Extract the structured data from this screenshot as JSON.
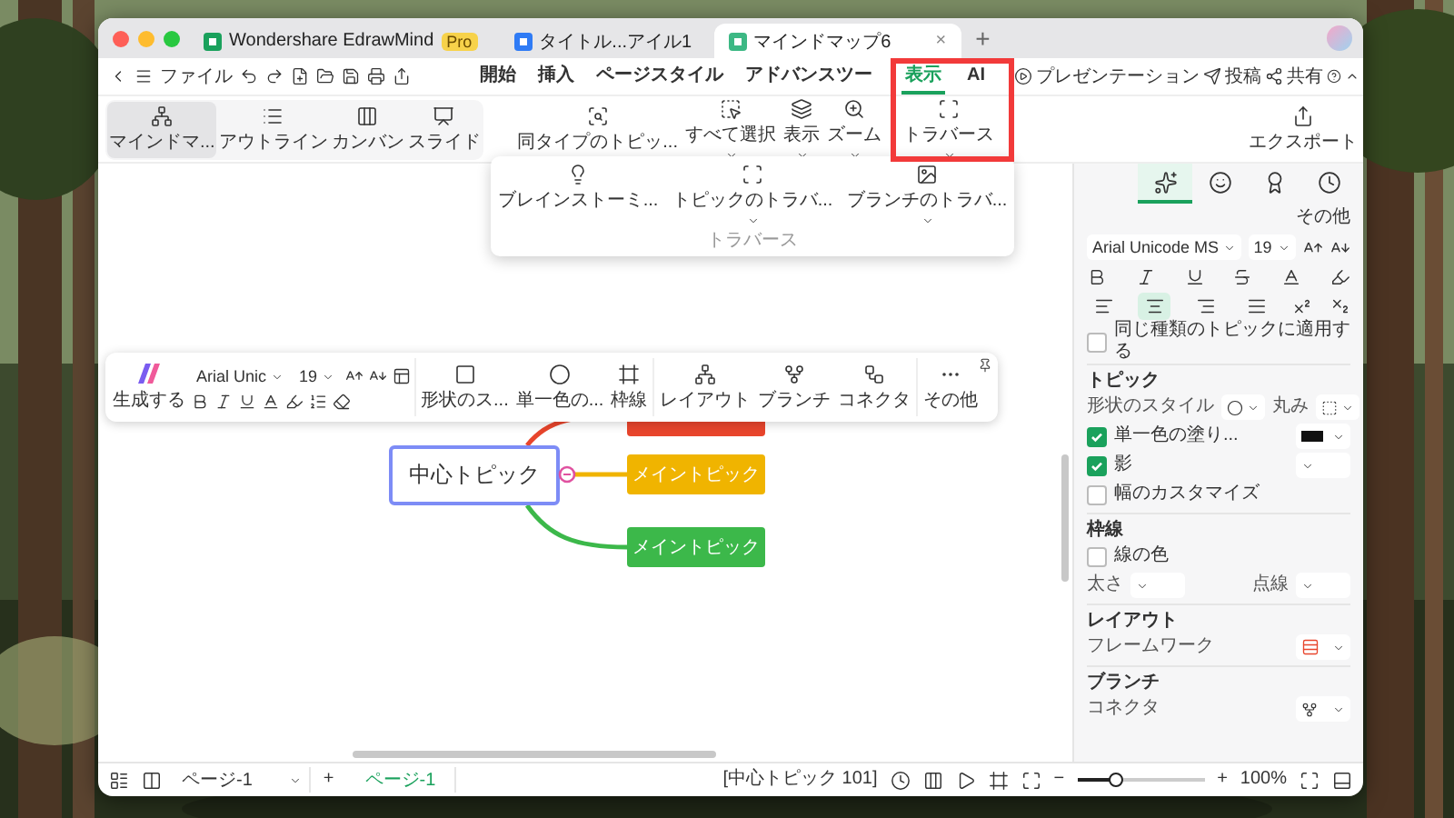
{
  "window": {
    "tabs": [
      {
        "kind": "app",
        "label": "Wondershare EdrawMind",
        "badge": "Pro",
        "selected": false
      },
      {
        "kind": "doc",
        "label": "タイトル...アイル1",
        "selected": false
      },
      {
        "kind": "map",
        "label": "マインドマップ6",
        "close": "×",
        "selected": true
      }
    ],
    "new_tab": "+"
  },
  "menu_bar": {
    "file": "ファイル",
    "tabs": [
      {
        "label": "開始",
        "selected": false
      },
      {
        "label": "挿入",
        "selected": false
      },
      {
        "label": "ページスタイル",
        "selected": false
      },
      {
        "label": "アドバンスツー",
        "selected": false
      },
      {
        "label": "表示",
        "selected": true
      },
      {
        "label": "AI",
        "selected": false
      }
    ],
    "actions": [
      {
        "kind": "present",
        "label": "プレゼンテーション"
      },
      {
        "kind": "post",
        "label": "投稿"
      },
      {
        "kind": "share",
        "label": "共有"
      }
    ]
  },
  "ribbon": {
    "views": [
      {
        "kind": "mindmap",
        "label": "マインドマ...",
        "selected": true
      },
      {
        "kind": "outline",
        "label": "アウトライン",
        "selected": false
      },
      {
        "kind": "kanban",
        "label": "カンバン",
        "selected": false
      },
      {
        "kind": "slide",
        "label": "スライド",
        "selected": false
      }
    ],
    "tools": [
      {
        "kind": "same",
        "label": "同タイプのトピッ...",
        "dropdown": false
      },
      {
        "kind": "select",
        "label": "すべて選択",
        "dropdown": true
      },
      {
        "kind": "display",
        "label": "表示",
        "dropdown": true
      },
      {
        "kind": "zoom",
        "label": "ズーム",
        "dropdown": true
      }
    ],
    "traverse": {
      "label": "トラバース",
      "dropdown": true
    },
    "export": "エクスポート"
  },
  "traverse_menu": {
    "items": [
      {
        "kind": "bulb",
        "label": "ブレインストーミ...",
        "dropdown": false
      },
      {
        "kind": "topic",
        "label": "トピックのトラバ...",
        "dropdown": true
      },
      {
        "kind": "branch",
        "label": "ブランチのトラバ...",
        "dropdown": true
      }
    ],
    "caption": "トラバース"
  },
  "floating_toolbar": {
    "generate": "生成する",
    "font": "Arial Unic",
    "size": "19",
    "tools": [
      {
        "kind": "shape",
        "label": "形状のス..."
      },
      {
        "kind": "fill",
        "label": "単一色の..."
      },
      {
        "kind": "border",
        "label": "枠線"
      },
      {
        "kind": "layout",
        "label": "レイアウト"
      },
      {
        "kind": "branch",
        "label": "ブランチ"
      },
      {
        "kind": "connector",
        "label": "コネクタ"
      },
      {
        "kind": "more",
        "label": "その他"
      }
    ]
  },
  "mind_map": {
    "central": "中心トピック",
    "topics": [
      {
        "color": "#e8452c"
      },
      {
        "text": "メイントピック",
        "color": "#f0b400"
      },
      {
        "text": "メイントピック",
        "color": "#3cb84a"
      }
    ]
  },
  "side_panel": {
    "tabs": [
      {
        "kind": "sparkle",
        "selected": true
      },
      {
        "kind": "face",
        "selected": false
      },
      {
        "kind": "badge",
        "selected": false
      },
      {
        "kind": "clock",
        "selected": false
      }
    ],
    "more": "その他",
    "font": "Arial Unicode MS",
    "size": "19",
    "align": [
      {
        "kind": "left",
        "selected": false
      },
      {
        "kind": "center",
        "selected": true
      },
      {
        "kind": "right",
        "selected": false
      },
      {
        "kind": "justify",
        "selected": false
      }
    ],
    "apply_same": {
      "label": "同じ種類のトピックに適用する",
      "checked": false
    },
    "topic": {
      "title": "トピック",
      "shape_style": "形状のスタイル",
      "rounding": "丸み",
      "fill": {
        "label": "単一色の塗り...",
        "checked": true
      },
      "shadow": {
        "label": "影",
        "checked": true
      },
      "custom_width": {
        "label": "幅のカスタマイズ",
        "checked": false
      }
    },
    "border": {
      "title": "枠線",
      "line_color": {
        "label": "線の色",
        "checked": false
      },
      "thickness": "太さ",
      "dash": "点線"
    },
    "layout": {
      "title": "レイアウト",
      "framework": "フレームワーク"
    },
    "branch": {
      "title": "ブランチ",
      "connector": "コネクタ"
    }
  },
  "status_bar": {
    "page_select": "ページ-1",
    "add": "+",
    "pages": [
      {
        "label": "ページ-1",
        "selected": true
      }
    ],
    "selection": "[中心トピック 101]",
    "zoom_out": "−",
    "zoom": {
      "level": 0.3
    },
    "zoom_in": "+",
    "zoom_value": "100%"
  }
}
